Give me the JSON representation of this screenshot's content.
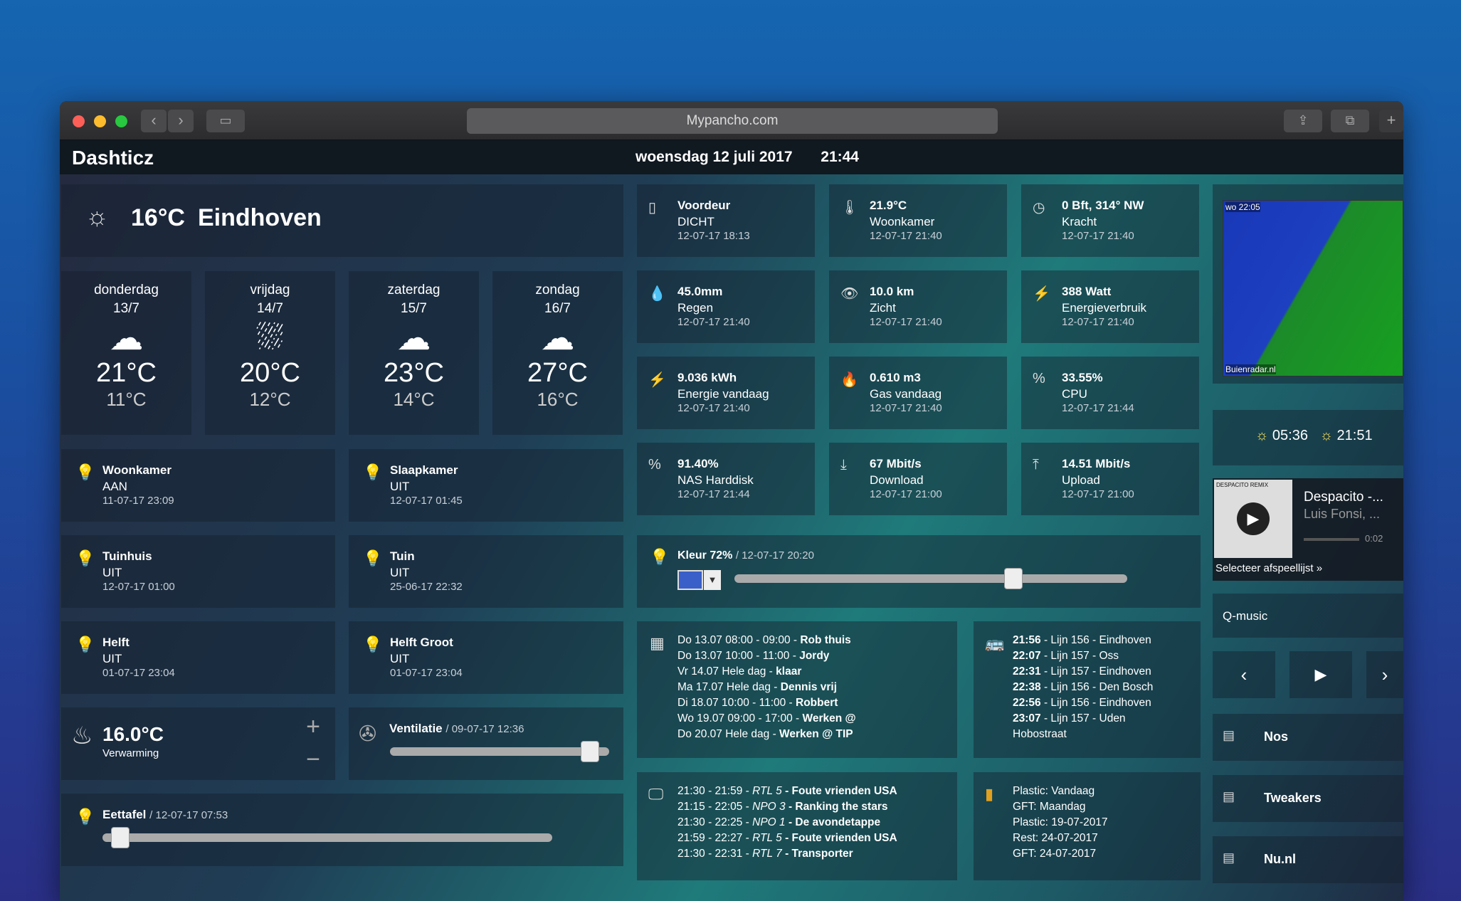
{
  "browser": {
    "url": "Mypancho.com"
  },
  "header": {
    "brand": "Dashticz",
    "date": "woensdag 12 juli 2017",
    "time": "21:44"
  },
  "weather": {
    "current": "16°C",
    "city": "Eindhoven",
    "days": [
      {
        "day": "donderdag",
        "date": "13/7",
        "high": "21°C",
        "low": "11°C"
      },
      {
        "day": "vrijdag",
        "date": "14/7",
        "high": "20°C",
        "low": "12°C"
      },
      {
        "day": "zaterdag",
        "date": "15/7",
        "high": "23°C",
        "low": "14°C"
      },
      {
        "day": "zondag",
        "date": "16/7",
        "high": "27°C",
        "low": "16°C"
      }
    ]
  },
  "lights": [
    {
      "name": "Woonkamer",
      "state": "AAN",
      "time": "11-07-17 23:09"
    },
    {
      "name": "Slaapkamer",
      "state": "UIT",
      "time": "12-07-17 01:45"
    },
    {
      "name": "Tuinhuis",
      "state": "UIT",
      "time": "12-07-17 01:00"
    },
    {
      "name": "Tuin",
      "state": "UIT",
      "time": "25-06-17 22:32"
    },
    {
      "name": "Helft",
      "state": "UIT",
      "time": "01-07-17 23:04"
    },
    {
      "name": "Helft Groot",
      "state": "UIT",
      "time": "01-07-17 23:04"
    }
  ],
  "heating": {
    "temp": "16.0°C",
    "label": "Verwarming",
    "plus": "+",
    "minus": "−"
  },
  "ventilation": {
    "name": "Ventilatie",
    "time": "/ 09-07-17 12:36",
    "level": 0.95
  },
  "eettafel": {
    "name": "Eettafel",
    "time": "/ 12-07-17 07:53",
    "level": 0.02
  },
  "sensors": [
    {
      "value": "Voordeur",
      "label": "DICHT",
      "time": "12-07-17 18:13"
    },
    {
      "value": "21.9°C",
      "label": "Woonkamer",
      "time": "12-07-17 21:40"
    },
    {
      "value": "0 Bft, 314° NW",
      "label": "Kracht",
      "time": "12-07-17 21:40"
    },
    {
      "value": "45.0mm",
      "label": "Regen",
      "time": "12-07-17 21:40"
    },
    {
      "value": "10.0 km",
      "label": "Zicht",
      "time": "12-07-17 21:40"
    },
    {
      "value": "388 Watt",
      "label": "Energieverbruik",
      "time": "12-07-17 21:40"
    },
    {
      "value": "9.036 kWh",
      "label": "Energie vandaag",
      "time": "12-07-17 21:40"
    },
    {
      "value": "0.610 m3",
      "label": "Gas vandaag",
      "time": "12-07-17 21:40"
    },
    {
      "value": "33.55%",
      "label": "CPU",
      "time": "12-07-17 21:44"
    },
    {
      "value": "91.40%",
      "label": "NAS Harddisk",
      "time": "12-07-17 21:44"
    },
    {
      "value": "67 Mbit/s",
      "label": "Download",
      "time": "12-07-17 21:00"
    },
    {
      "value": "14.51 Mbit/s",
      "label": "Upload",
      "time": "12-07-17 21:00"
    }
  ],
  "kleur": {
    "label": "Kleur 72%",
    "time": "/ 12-07-17 20:20",
    "level": 0.72,
    "swatch": "#3a5fc8"
  },
  "calendar": [
    {
      "when": "Do 13.07 08:00 - 09:00 - ",
      "what": "Rob thuis"
    },
    {
      "when": "Do 13.07 10:00 - 11:00 - ",
      "what": "Jordy"
    },
    {
      "when": "Vr 14.07 Hele dag - ",
      "what": "klaar"
    },
    {
      "when": "Ma 17.07 Hele dag - ",
      "what": "Dennis vrij"
    },
    {
      "when": "Di 18.07 10:00 - 11:00 - ",
      "what": "Robbert"
    },
    {
      "when": "Wo 19.07 09:00 - 17:00 - ",
      "what": "Werken @"
    },
    {
      "when": "Do 20.07 Hele dag - ",
      "what": "Werken @ TIP"
    }
  ],
  "buses": [
    {
      "time": "21:56",
      "line": " - Lijn 156 - Eindhoven"
    },
    {
      "time": "22:07",
      "line": " - Lijn 157 - Oss"
    },
    {
      "time": "22:31",
      "line": " - Lijn 157 - Eindhoven"
    },
    {
      "time": "22:38",
      "line": " - Lijn 156 - Den Bosch"
    },
    {
      "time": "22:56",
      "line": " - Lijn 156 - Eindhoven"
    },
    {
      "time": "23:07",
      "line": " - Lijn 157 - Uden"
    },
    {
      "time": "",
      "line": "Hobostraat"
    }
  ],
  "tv": [
    {
      "time": "21:30 - 21:59 - ",
      "ch": "RTL 5",
      "show": " - Foute vrienden USA"
    },
    {
      "time": "21:15 - 22:05 - ",
      "ch": "NPO 3",
      "show": " - Ranking the stars"
    },
    {
      "time": "21:30 - 22:25 - ",
      "ch": "NPO 1",
      "show": " - De avondetappe"
    },
    {
      "time": "21:59 - 22:27 - ",
      "ch": "RTL 5",
      "show": " - Foute vrienden USA"
    },
    {
      "time": "21:30 - 22:31 - ",
      "ch": "RTL 7",
      "show": " - Transporter"
    }
  ],
  "garbage": [
    "Plastic: Vandaag",
    "GFT: Maandag",
    "Plastic: 19-07-2017",
    "Rest: 24-07-2017",
    "GFT: 24-07-2017"
  ],
  "radar": {
    "timestamp": "wo 22:05",
    "credit": "Buienradar.nl"
  },
  "sun": {
    "rise": "05:36",
    "set": "21:51"
  },
  "music": {
    "title": "Despacito -...",
    "artist": "Luis Fonsi, ...",
    "elapsed": "0:02",
    "playlist": "Selecteer afspeellijst »",
    "cover_text": "DESPACITO REMIX",
    "station": "Q-music"
  },
  "news": [
    "Nos",
    "Tweakers",
    "Nu.nl"
  ]
}
